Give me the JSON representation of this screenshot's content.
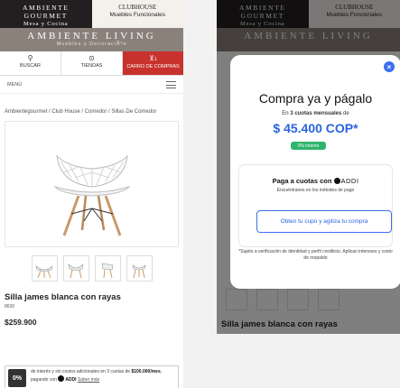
{
  "header": {
    "brand_left_name": "AMBIENTE GOURMET",
    "brand_left_tag": "Mesa y Cocina",
    "brand_right_name": "CLUBHOUSE",
    "brand_right_tag": "Muebles Funcionales",
    "living_name": "AMBIENTE LIVING",
    "living_tag": "Muebles y DecoraciÃ³n"
  },
  "nav": {
    "search_label": "BUSCAR",
    "search_icon": "search-icon",
    "stores_label": "TIENDAS",
    "stores_icon": "location-pin-icon",
    "cart_label": "CARRO DE COMPRAS",
    "cart_count": "1",
    "cart_icon": "cart-icon",
    "menu_label": "MENÚ"
  },
  "breadcrumb": {
    "text": "Ambientegourmet / Club House / Comedor / Sillas De Comedor"
  },
  "product": {
    "title": "Silla james blanca con rayas",
    "sku": "8630",
    "price": "$259.900",
    "thumb_count": 4
  },
  "financing": {
    "badge": "0%",
    "line1": "de interés y sin costos adicionales en 3 cuotas de",
    "amount": "$100.000/mes",
    "line2": ", pagando con",
    "provider": "ADDI",
    "link": "Saber más"
  },
  "modal": {
    "headline": "Compra ya y págalo",
    "sub_prefix": "En",
    "sub_bold": "3 cuotas mensuales",
    "sub_suffix": "de",
    "price": "$ 45.400 COP*",
    "badge": "0% interés",
    "card_title": "Paga a cuotas con",
    "card_brand": "ADDI",
    "card_sub": "Encuéntranos en los métodos de pago",
    "card_button": "Obten tu cupo y agiliza tu compra",
    "footnote": "*Sujeto a verificación de identidad y perfil crediticio. Aplican intereses y costo de respaldo"
  },
  "right_bg_title": "Silla james blanca con rayas",
  "colors": {
    "accent_blue": "#2b63e0",
    "cart_red": "#c8322c",
    "green_badge": "#2fb46b",
    "living_brown": "#8a817b"
  }
}
